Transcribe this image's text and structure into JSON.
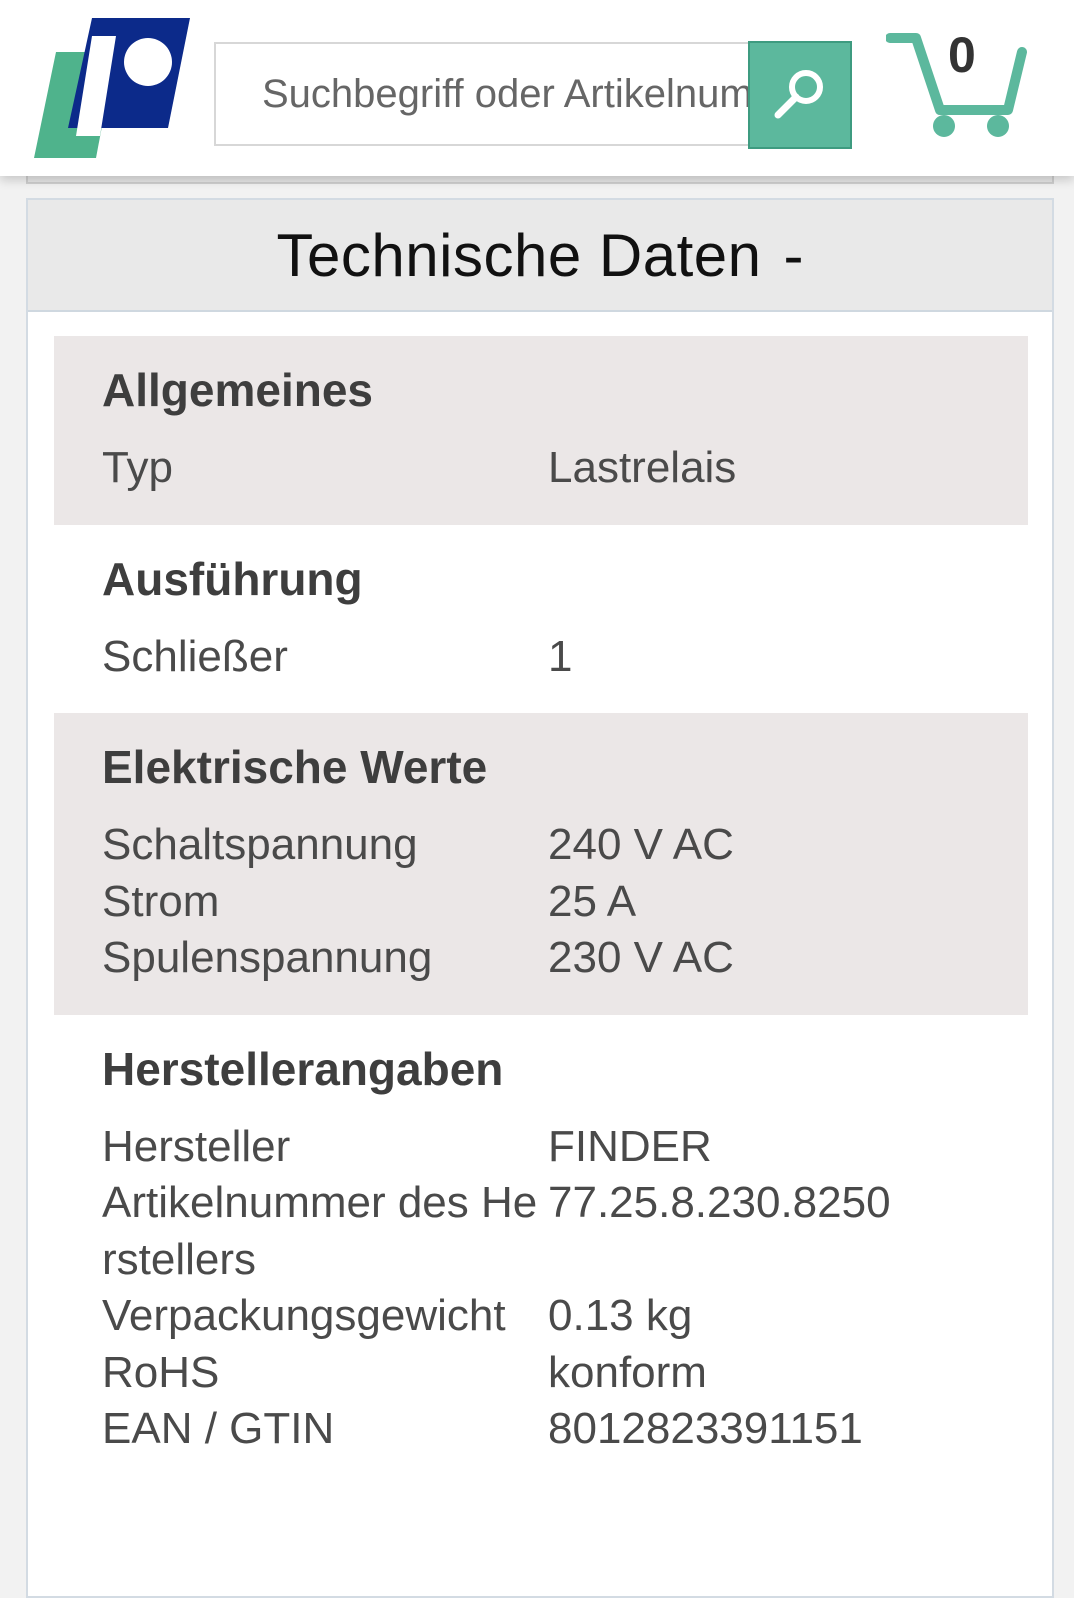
{
  "header": {
    "search_placeholder": "Suchbegriff oder Artikelnummer",
    "cart_count": "0",
    "colors": {
      "accent": "#5cb89d",
      "logo_blue": "#0c2a8a",
      "logo_green": "#4fb38c"
    }
  },
  "panel": {
    "title": "Technische Daten",
    "toggle": "-"
  },
  "sections": [
    {
      "heading": "Allgemeines",
      "rows": [
        {
          "key": "Typ",
          "value": "Lastrelais"
        }
      ]
    },
    {
      "heading": "Ausführung",
      "rows": [
        {
          "key": "Schließer",
          "value": "1"
        }
      ]
    },
    {
      "heading": "Elektrische Werte",
      "rows": [
        {
          "key": "Schaltspannung",
          "value": "240 V AC"
        },
        {
          "key": "Strom",
          "value": "25 A"
        },
        {
          "key": "Spulenspannung",
          "value": "230 V AC"
        }
      ]
    },
    {
      "heading": "Herstellerangaben",
      "rows": [
        {
          "key": "Hersteller",
          "value": "FINDER"
        },
        {
          "key": "Artikelnummer des Herstellers",
          "value": "77.25.8.230.8250"
        },
        {
          "key": "Verpackungsgewicht",
          "value": "0.13 kg"
        },
        {
          "key": "RoHS",
          "value": "konform"
        },
        {
          "key": "EAN / GTIN",
          "value": "8012823391151"
        }
      ]
    }
  ]
}
